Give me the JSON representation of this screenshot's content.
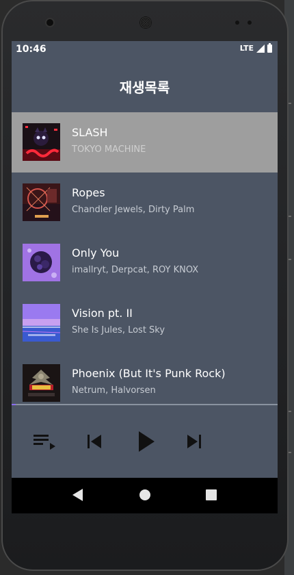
{
  "status_bar": {
    "time": "10:46",
    "network": "LTE"
  },
  "header": {
    "title": "재생목록"
  },
  "playlist": {
    "tracks": [
      {
        "title": "SLASH",
        "artist": "TOKYO MACHINE",
        "selected": true,
        "art_icon": "slash-cover-art"
      },
      {
        "title": "Ropes",
        "artist": "Chandler Jewels, Dirty Palm",
        "selected": false,
        "art_icon": "ropes-cover-art"
      },
      {
        "title": "Only You",
        "artist": "imallryt, Derpcat, ROY KNOX",
        "selected": false,
        "art_icon": "only-you-cover-art"
      },
      {
        "title": "Vision pt. II",
        "artist": "She Is Jules, Lost Sky",
        "selected": false,
        "art_icon": "vision-cover-art"
      },
      {
        "title": "Phoenix (But It's Punk Rock)",
        "artist": "Netrum, Halvorsen",
        "selected": false,
        "art_icon": "phoenix-cover-art"
      }
    ]
  },
  "player": {
    "progress": 0.015,
    "controls": [
      "playlist-queue-icon",
      "skip-previous-icon",
      "play-icon",
      "skip-next-icon"
    ]
  },
  "nav": {
    "buttons": [
      "back-icon",
      "home-icon",
      "recents-icon"
    ]
  },
  "colors": {
    "screen_bg": "#4c5564",
    "selected_row": "#9e9e9e",
    "progress_accent": "#8b6cf0",
    "nav_bg": "#000000"
  }
}
